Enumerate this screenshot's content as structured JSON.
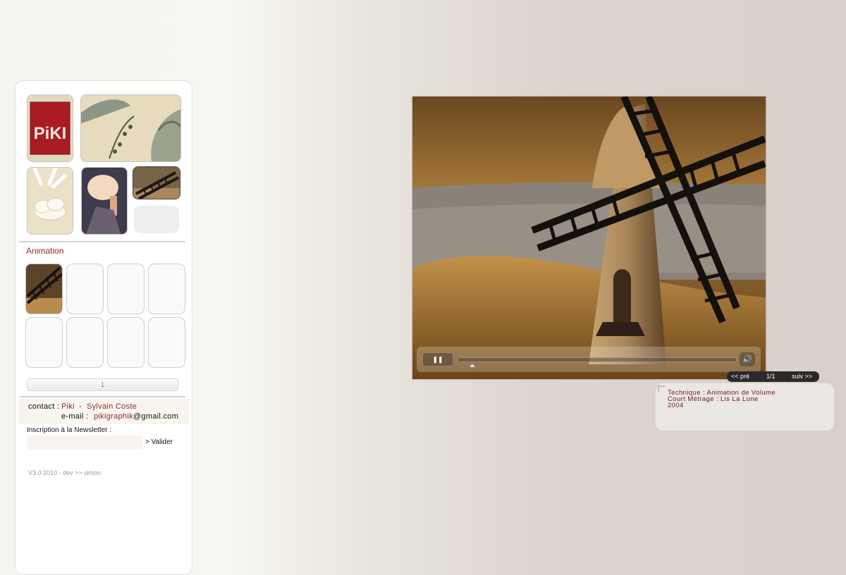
{
  "sidebar": {
    "section_title": "Animation",
    "pager": {
      "current": "1"
    },
    "contact": {
      "label": "contact :",
      "name_first": "Piki",
      "separator": "-",
      "name_second": "Sylvain Coste",
      "email_label": "e-mail :",
      "email_user": "pikigraphik",
      "email_domain": "@gmail.com"
    },
    "newsletter": {
      "label": "Inscription à la Newsletter :",
      "input_value": "",
      "submit": "> Valider"
    },
    "footer": "V3.0 2010 - dev >> simon",
    "logo_text": "PiKI"
  },
  "player": {
    "pause_icon": "pause-icon",
    "volume_icon": "volume-icon",
    "progress": 0.0
  },
  "nav": {
    "prev": "<< pré",
    "counter": "1/1",
    "next": "suiv >>"
  },
  "info": {
    "technique": "Technique : Animation de Volume",
    "court": "Court Métrage : Lis La Lune",
    "year": "2004"
  },
  "colors": {
    "accent_red": "#8a2e2a",
    "info_text": "#6e2020"
  }
}
